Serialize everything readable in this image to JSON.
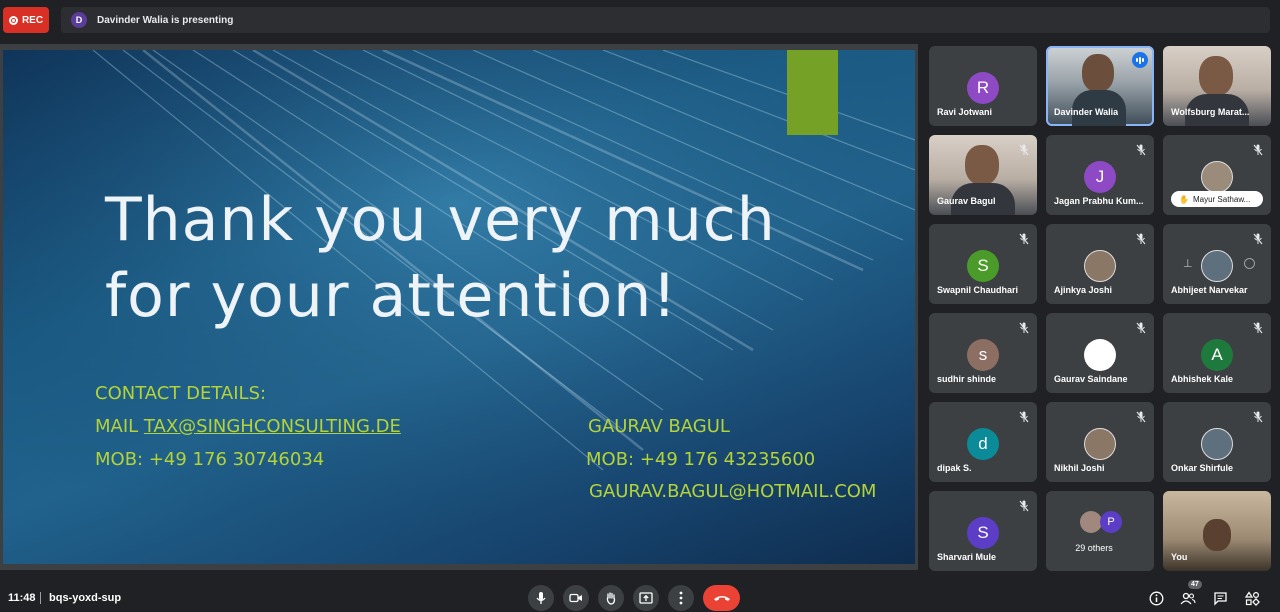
{
  "recording": {
    "label": "REC"
  },
  "presenter_bar": {
    "avatar_letter": "D",
    "text": "Davinder Walia is presenting"
  },
  "slide": {
    "title_line1": "Thank you very much",
    "title_line2": "for your attention!",
    "contact_heading": "CONTACT DETAILS:",
    "mail_prefix": "MAIL ",
    "mail_link": "TAX@SINGHCONSULTING.DE",
    "mobile_left": "MOB: +49 176 30746034",
    "person_name": "GAURAV BAGUL",
    "mobile_right": "MOB: +49 176 43235600",
    "email_right": "GAURAV.BAGUL@HOTMAIL.COM"
  },
  "participants": [
    {
      "name": "Ravi Jotwani",
      "letter": "R",
      "color": "#8e49c4"
    },
    {
      "name": "Davinder Walia",
      "speaking": true
    },
    {
      "name": "Wolfsburg Marat..."
    },
    {
      "name": "Gaurav Bagul",
      "muted": true
    },
    {
      "name": "Jagan Prabhu Kum...",
      "letter": "J",
      "color": "#8e49c4",
      "muted": true
    },
    {
      "name": "Mayur Sathaw...",
      "muted": true
    },
    {
      "name": "Swapnil Chaudhari",
      "letter": "S",
      "color": "#4b9b2b",
      "muted": true
    },
    {
      "name": "Ajinkya Joshi",
      "muted": true
    },
    {
      "name": "Abhijeet Narvekar",
      "muted": true
    },
    {
      "name": "sudhir shinde",
      "letter": "s",
      "color": "#8d6e63",
      "muted": true
    },
    {
      "name": "Gaurav Saindane",
      "muted": true
    },
    {
      "name": "Abhishek Kale",
      "letter": "A",
      "color": "#1e7a3c",
      "muted": true
    },
    {
      "name": "dipak S.",
      "letter": "d",
      "color": "#0b8a97",
      "muted": true
    },
    {
      "name": "Nikhil Joshi",
      "muted": true
    },
    {
      "name": "Onkar Shirfule",
      "muted": true
    },
    {
      "name": "Sharvari Mule",
      "letter": "S",
      "color": "#5c3ec6",
      "muted": true
    },
    {
      "name": "29 others",
      "letter": "P"
    },
    {
      "name": "You"
    }
  ],
  "bottom_bar": {
    "time": "11:48",
    "meeting_code": "bqs-yoxd-sup",
    "people_count": "47"
  },
  "icons": [
    "mic-icon",
    "camera-icon",
    "raise-hand-icon",
    "present-icon",
    "more-icon",
    "end-call-icon",
    "info-icon",
    "people-icon",
    "chat-icon",
    "activities-icon"
  ]
}
